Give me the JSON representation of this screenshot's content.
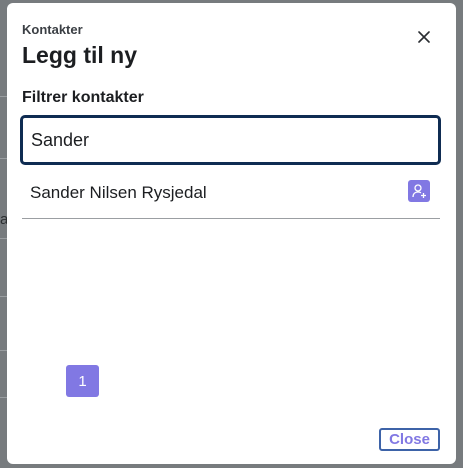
{
  "background": {
    "partial_glyph": "a"
  },
  "modal": {
    "eyebrow": "Kontakter",
    "title": "Legg til ny",
    "close_icon": "close-icon"
  },
  "filter": {
    "label": "Filtrer kontakter",
    "value": "Sander"
  },
  "results": [
    {
      "name": "Sander Nilsen Rysjedal",
      "action_icon": "add-user-icon"
    }
  ],
  "pagination": {
    "current_page": "1"
  },
  "footer": {
    "close_label": "Close"
  },
  "colors": {
    "accent": "#8178e3",
    "input_border": "#0f2c52",
    "close_border": "#3d63a8",
    "overlay": "#777b7e"
  }
}
